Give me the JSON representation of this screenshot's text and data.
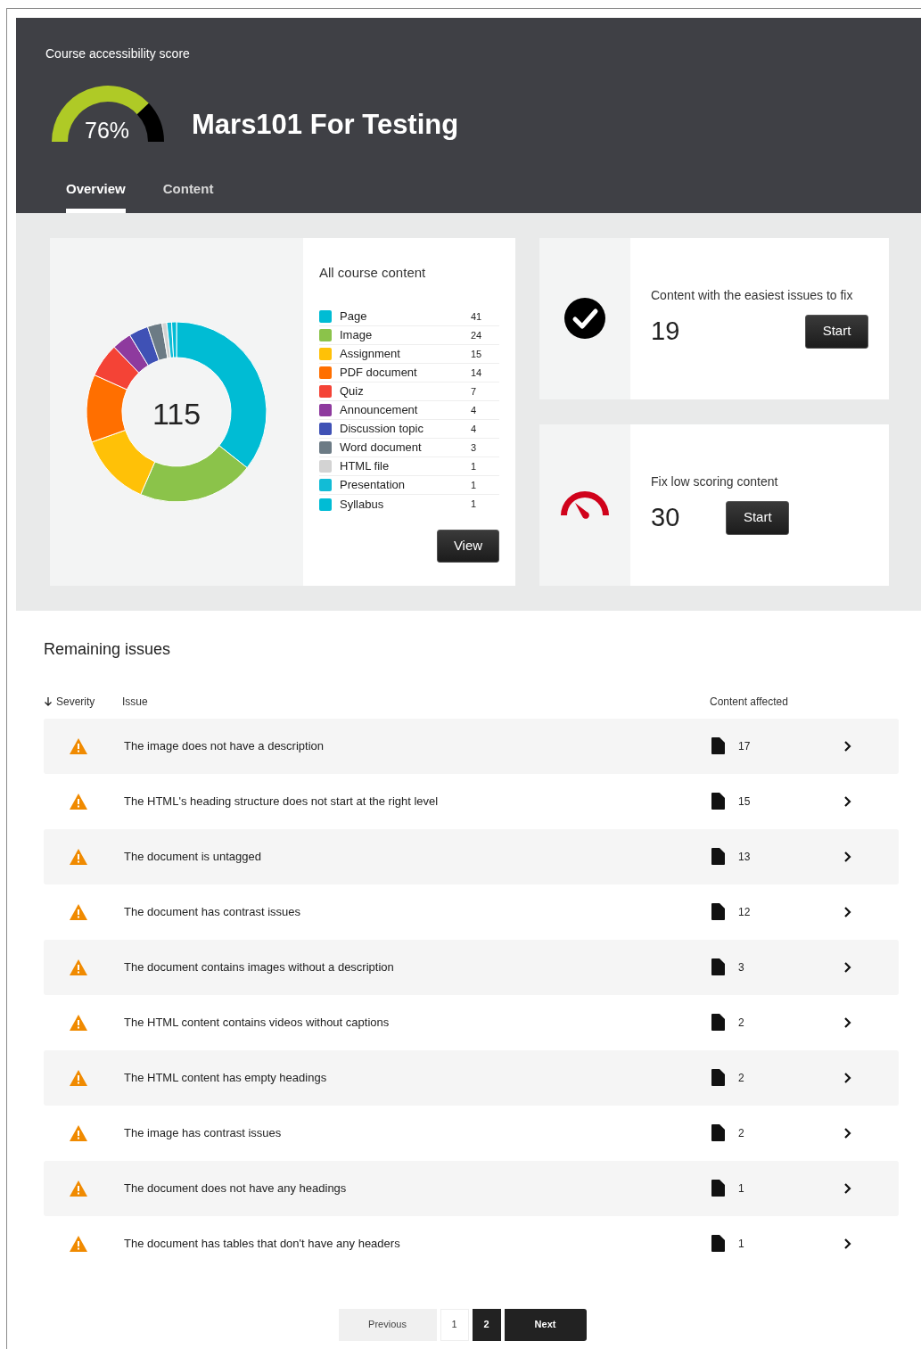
{
  "header": {
    "score_label": "Course accessibility score",
    "score": {
      "text": "76%"
    },
    "title": "Mars101 For Testing"
  },
  "tabs": [
    {
      "label": "Overview",
      "selected": true
    },
    {
      "label": "Content",
      "selected": false
    }
  ],
  "content_card": {
    "title": "All course content",
    "total": "115",
    "chart_data": {
      "type": "donut",
      "values": [
        35.65,
        20.87,
        13.04,
        12.17,
        6.09,
        3.48,
        3.48,
        2.61,
        0.87,
        0.87,
        0.87
      ]
    },
    "legend": [
      {
        "label": "Page",
        "count": "41",
        "color": "#00bcd4"
      },
      {
        "label": "Image",
        "count": "24",
        "color": "#8bc34a"
      },
      {
        "label": "Assignment",
        "count": "15",
        "color": "#ffc107"
      },
      {
        "label": "PDF document",
        "count": "14",
        "color": "#ff6f00"
      },
      {
        "label": "Quiz",
        "count": "7",
        "color": "#f44336"
      },
      {
        "label": "Announcement",
        "count": "4",
        "color": "#8e3a9e"
      },
      {
        "label": "Discussion topic",
        "count": "4",
        "color": "#3f51b5"
      },
      {
        "label": "Word document",
        "count": "3",
        "color": "#6c7b85"
      },
      {
        "label": "HTML file",
        "count": "1",
        "color": "#d3d3d3"
      },
      {
        "label": "Presentation",
        "count": "1",
        "color": "#12bcd6"
      },
      {
        "label": "Syllabus",
        "count": "1",
        "color": "#00bcd5"
      }
    ],
    "button": "View"
  },
  "action_cards": [
    {
      "kind": "easy",
      "title": "Content with the easiest issues to fix",
      "count": "19",
      "button": "Start"
    },
    {
      "kind": "low",
      "title": "Fix low scoring content",
      "count": "30",
      "button": "Start"
    }
  ],
  "issues": {
    "title": "Remaining issues",
    "columns": [
      "Severity",
      "Issue",
      "Content affected"
    ],
    "rows": [
      {
        "issue": "The image does not have a description",
        "count": "17"
      },
      {
        "issue": "The HTML's heading structure does not start at the right level",
        "count": "15"
      },
      {
        "issue": "The document is untagged",
        "count": "13"
      },
      {
        "issue": "The document has contrast issues",
        "count": "12"
      },
      {
        "issue": "The document contains images without a description",
        "count": "3"
      },
      {
        "issue": "The HTML content contains videos without captions",
        "count": "2"
      },
      {
        "issue": "The HTML content has empty headings",
        "count": "2"
      },
      {
        "issue": "The image has contrast issues",
        "count": "2"
      },
      {
        "issue": "The document does not have any headings",
        "count": "1"
      },
      {
        "issue": "The document has tables that don't have any headers",
        "count": "1"
      }
    ]
  },
  "pagination": {
    "previous": "Previous",
    "pages": [
      {
        "label": "1",
        "selected": false
      },
      {
        "label": "2",
        "selected": true
      }
    ],
    "next": "Next"
  }
}
